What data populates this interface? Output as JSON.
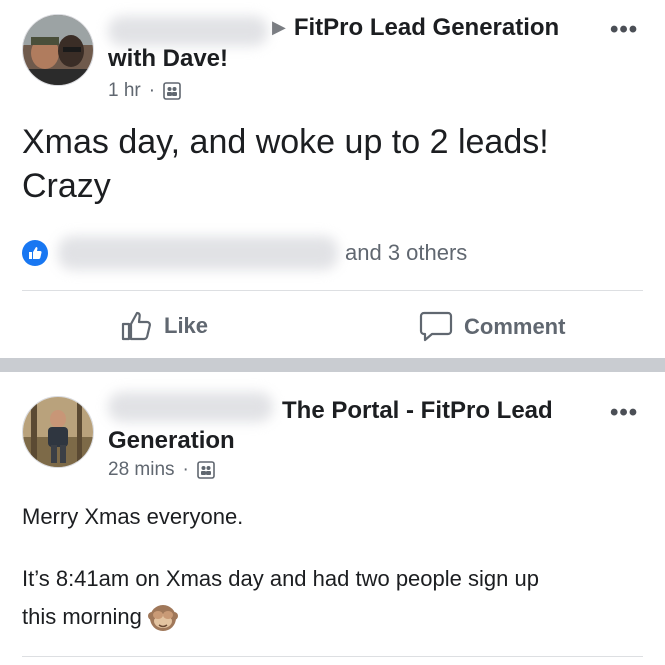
{
  "posts": [
    {
      "group": "FitPro Lead Generation",
      "author_line2": "with Dave!",
      "time": "1 hr",
      "text_lines": [
        "Xmas day, and woke up to 2 leads!",
        "Crazy"
      ],
      "reactions_text": "and 3 others",
      "actions": {
        "like": "Like",
        "comment": "Comment"
      }
    },
    {
      "group_line1": "The Portal - FitPro Lead",
      "group_line2": "Generation",
      "time": "28 mins",
      "paragraph1": "Merry Xmas everyone.",
      "paragraph2_line1": "It’s 8:41am on Xmas day and had two people sign up",
      "paragraph2_line2": "this morning"
    }
  ],
  "separator": "·",
  "more_glyph": "•••"
}
